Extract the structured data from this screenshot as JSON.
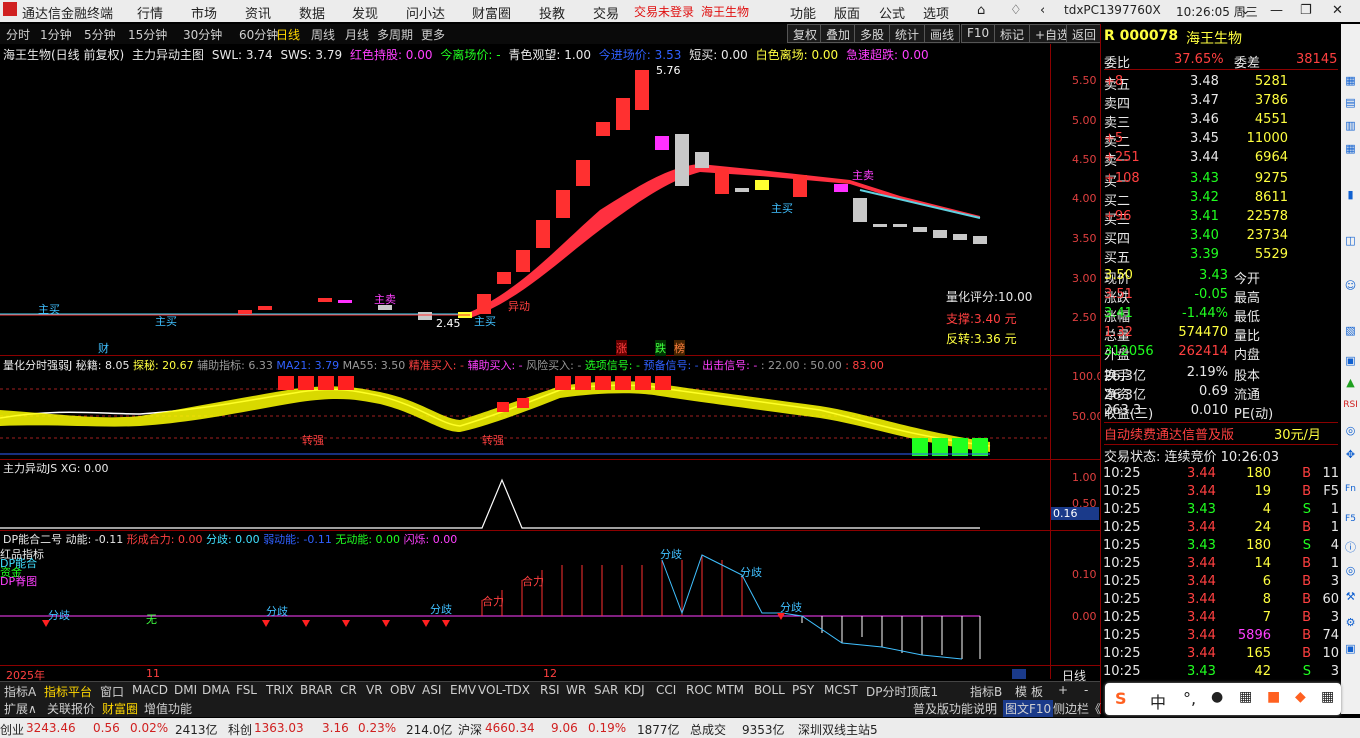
{
  "app": {
    "title": "通达信金融终端",
    "menus": [
      "行情",
      "市场",
      "资讯",
      "数据",
      "发现",
      "问小达",
      "财富圈",
      "投教",
      "交易"
    ],
    "trade_status": "交易未登录",
    "stock_tag": "海王生物",
    "right_menus": [
      "功能",
      "版面",
      "公式",
      "选项"
    ],
    "user": "tdxPC1397760X",
    "clock": "10:26:05 周三"
  },
  "timeframes": [
    "分时",
    "1分钟",
    "5分钟",
    "15分钟",
    "30分钟",
    "60分钟",
    "日线",
    "周线",
    "月线",
    "多周期",
    "更多"
  ],
  "active_tf": "日线",
  "toolbar": [
    "复权",
    "叠加",
    "多股",
    "统计",
    "画线",
    "F10",
    "标记",
    "+自选",
    "返回"
  ],
  "main_panel": {
    "title": "海王生物(日线 前复权)",
    "indicator": "主力异动主图",
    "swl": "SWL: 3.74",
    "sws": "SWS: 3.79",
    "hongse": "红色持股: 0.00",
    "jinli": "今离场价: -",
    "qingse": "青色观望: 1.00",
    "jinjin": "今进场价: 3.53",
    "duanmai": "短买: 0.00",
    "baise": "白色离场: 0.00",
    "jisu": "急速超跌: 0.00",
    "yticks": [
      "5.50",
      "5.00",
      "4.50",
      "4.00",
      "3.50",
      "3.00",
      "2.50"
    ],
    "score": "量化评分:10.00",
    "support": "支撑:3.40 元",
    "reversal": "反转:3.36 元",
    "high_label": "5.76",
    "low_label": "2.45",
    "zhumai": "主买",
    "zhumai2": "主卖",
    "yidong": "异动",
    "markers": {
      "cai": "财",
      "zhang": "涨",
      "die": "跌",
      "bang": "榜"
    }
  },
  "panel2": {
    "title": "量化分时强弱J",
    "mi": "秘籍: 8.05",
    "tan": "探秘: 20.67",
    "fz": "辅助指标: 6.33",
    "ma21": "MA21: 3.79",
    "ma55": "MA55: 3.50",
    "jz": "精准买入: -",
    "fzb": "辅助买入: -",
    "fx": "风险买入: -",
    "xx": "选项信号: -",
    "yb": "预备信号: -",
    "cj": "出击信号: -",
    "v1": ": 22.00",
    "v2": ": 50.00",
    "v3": ": 83.00",
    "yticks": [
      "100.0",
      "50.00"
    ],
    "zq": "转强"
  },
  "panel3": {
    "title": "主力异动JS",
    "xg": "XG: 0.00",
    "yticks": [
      "1.00",
      "0.50"
    ],
    "val": "0.16"
  },
  "panel4": {
    "title": "DP能合二号",
    "dn": "动能: -0.11",
    "xc": "形成合力: 0.00",
    "fq": "分歧: 0.00",
    "rd": "弱动能: -0.11",
    "wd": "无动能: 0.00",
    "sl": "闪烁: 0.00",
    "yticks": [
      "0.10",
      "0.00"
    ],
    "fenqi": "分歧",
    "heli": "合力",
    "wu": "无",
    "legend": [
      "红品指标",
      "DP能合",
      "资金",
      "DP脊图"
    ]
  },
  "dates": {
    "y2025": "2025年",
    "m11": "11",
    "m12": "12",
    "period": "日线"
  },
  "quote": {
    "code": "000078",
    "name": "海王生物",
    "wb": "委比",
    "wbv": "37.65%",
    "wc": "委差",
    "wcv": "38145",
    "asks": [
      [
        "卖五",
        "3.48",
        "5281",
        "+8"
      ],
      [
        "卖四",
        "3.47",
        "3786",
        ""
      ],
      [
        "卖三",
        "3.46",
        "4551",
        ""
      ],
      [
        "卖二",
        "3.45",
        "11000",
        "+5"
      ],
      [
        "卖一",
        "3.44",
        "6964",
        "+251"
      ]
    ],
    "bids": [
      [
        "买一",
        "3.43",
        "9275",
        "+108"
      ],
      [
        "买二",
        "3.42",
        "8611",
        ""
      ],
      [
        "买三",
        "3.41",
        "22578",
        "+96"
      ],
      [
        "买四",
        "3.40",
        "23734",
        ""
      ],
      [
        "买五",
        "3.39",
        "5529",
        ""
      ]
    ],
    "stats": [
      [
        "现价",
        "3.43",
        "今开",
        "3.50"
      ],
      [
        "涨跌",
        "-0.05",
        "最高",
        "3.51"
      ],
      [
        "涨幅",
        "-1.44%",
        "最低",
        "3.41"
      ],
      [
        "总量",
        "574470",
        "量比",
        "1.32"
      ],
      [
        "外盘",
        "262414",
        "内盘",
        "312056"
      ]
    ],
    "stats2": [
      [
        "换手",
        "2.19%",
        "股本",
        "26.3亿"
      ],
      [
        "净资",
        "0.69",
        "流通",
        "26.3亿"
      ],
      [
        "收益(三)",
        "0.010",
        "PE(动)",
        "263.3"
      ]
    ],
    "ad": "自动续费通达信普及版",
    "price_ad": "30元/月",
    "trade_state": "交易状态: 连续竞价 10:26:03"
  },
  "ticks": [
    [
      "10:25",
      "3.44",
      "180",
      "B",
      "11"
    ],
    [
      "10:25",
      "3.44",
      "19",
      "B",
      "F5"
    ],
    [
      "10:25",
      "3.43",
      "4",
      "S",
      "1"
    ],
    [
      "10:25",
      "3.44",
      "24",
      "B",
      "1"
    ],
    [
      "10:25",
      "3.43",
      "180",
      "S",
      "4"
    ],
    [
      "10:25",
      "3.44",
      "14",
      "B",
      "1"
    ],
    [
      "10:25",
      "3.44",
      "6",
      "B",
      "3"
    ],
    [
      "10:25",
      "3.44",
      "8",
      "B",
      "60"
    ],
    [
      "10:25",
      "3.44",
      "7",
      "B",
      "3"
    ],
    [
      "10:25",
      "3.44",
      "5896",
      "B",
      "74"
    ],
    [
      "10:25",
      "3.44",
      "165",
      "B",
      "10"
    ],
    [
      "10:25",
      "3.43",
      "42",
      "S",
      "3"
    ]
  ],
  "tabs": [
    "指标A",
    "指标平台",
    "窗口",
    "MACD",
    "DMI",
    "DMA",
    "FSL",
    "TRIX",
    "BRAR",
    "CR",
    "VR",
    "OBV",
    "ASI",
    "EMV",
    "VOL-TDX",
    "RSI",
    "WR",
    "SAR",
    "KDJ",
    "CCI",
    "ROC",
    "MTM",
    "BOLL",
    "PSY",
    "MCST",
    "DP分时顶底1",
    "指标B",
    "模",
    "板",
    "+",
    "-"
  ],
  "tabs2": [
    "扩展∧",
    "关联报价",
    "财富圈",
    "增值功能"
  ],
  "tabs2_right": [
    "普及版功能说明",
    "图文F10",
    "侧边栏《"
  ],
  "status": {
    "cy": "创业",
    "cyv": "3243.46",
    "cyc": "0.56",
    "cyp": "0.02%",
    "cya": "2413亿",
    "kc": "科创",
    "kcv": "1363.03",
    "kcc": "3.16",
    "kcp": "0.23%",
    "kca": "214.0亿",
    "hs": "沪深",
    "hsv": "4660.34",
    "hsc": "9.06",
    "hsp": "0.19%",
    "hsa": "1877亿",
    "zc": "总成交",
    "zcv": "9353亿",
    "site": "深圳双线主站5"
  },
  "ime": {
    "s": "S",
    "zh": "中",
    "dot": "°,",
    "mic": "🎤"
  }
}
